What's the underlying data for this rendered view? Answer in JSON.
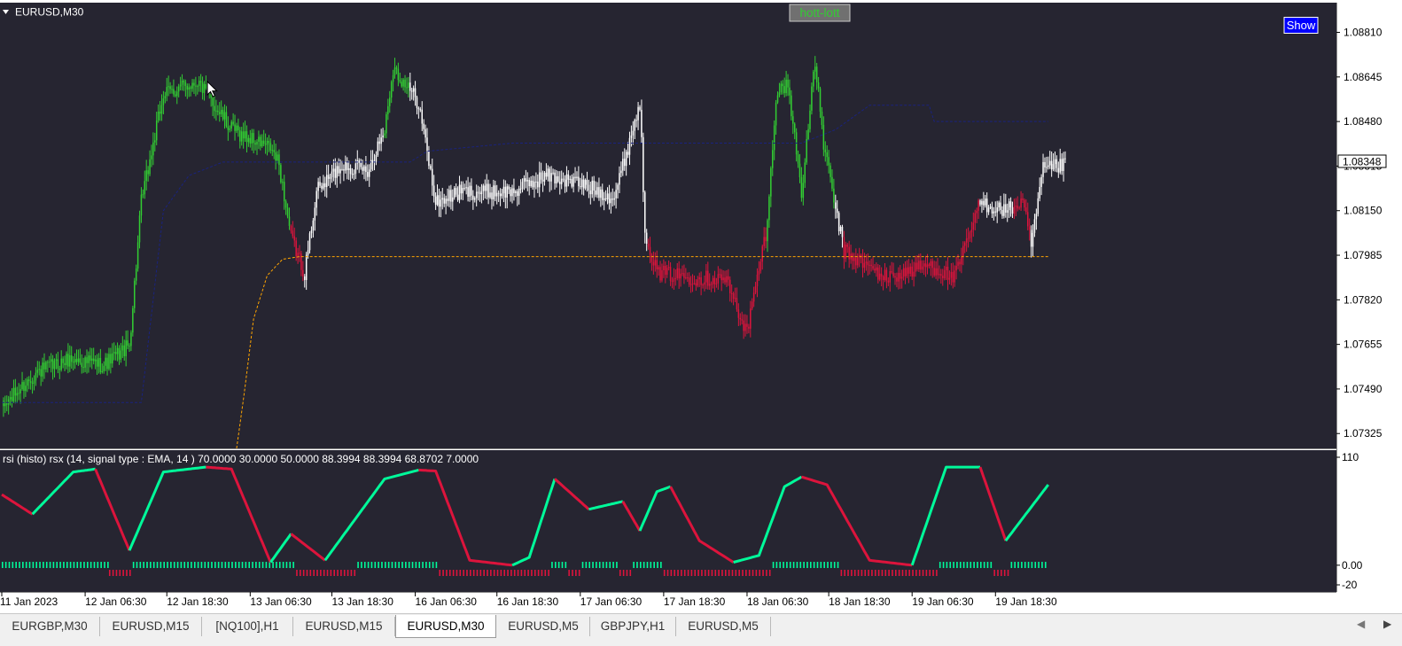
{
  "window": {
    "symbol_title": "EURUSD,M30"
  },
  "overlay": {
    "hott_lott_label": "hott-lott",
    "show_button": "Show"
  },
  "colors": {
    "background": "#262531",
    "bull": "#32cd32",
    "bear": "#dc143c",
    "neutral": "#ffffff",
    "rsx_up": "#00fa9a",
    "rsx_down": "#dc143c",
    "ma_blue": "#1a237e",
    "ma_orange": "#ffa500"
  },
  "chart_data": [
    {
      "type": "candlestick",
      "symbol": "EURUSD",
      "timeframe": "M30",
      "price_ticks": [
        "1.08810",
        "1.08645",
        "1.08480",
        "1.08315",
        "1.08150",
        "1.07985",
        "1.07820",
        "1.07655",
        "1.07490",
        "1.07325"
      ],
      "current_price": "1.08348",
      "ylim": [
        1.0727,
        1.0892
      ],
      "anchors": [
        {
          "i": 0,
          "p": 1.0742
        },
        {
          "i": 20,
          "p": 1.0755
        },
        {
          "i": 40,
          "p": 1.076
        },
        {
          "i": 60,
          "p": 1.0758
        },
        {
          "i": 75,
          "p": 1.0765
        },
        {
          "i": 82,
          "p": 1.0818
        },
        {
          "i": 95,
          "p": 1.0858
        },
        {
          "i": 115,
          "p": 1.0863
        },
        {
          "i": 135,
          "p": 1.0845
        },
        {
          "i": 158,
          "p": 1.0838
        },
        {
          "i": 163,
          "p": 1.0832
        },
        {
          "i": 170,
          "p": 1.0805
        },
        {
          "i": 178,
          "p": 1.0792
        },
        {
          "i": 185,
          "p": 1.0822
        },
        {
          "i": 200,
          "p": 1.0832
        },
        {
          "i": 215,
          "p": 1.083
        },
        {
          "i": 225,
          "p": 1.0845
        },
        {
          "i": 230,
          "p": 1.0868
        },
        {
          "i": 245,
          "p": 1.0855
        },
        {
          "i": 255,
          "p": 1.0818
        },
        {
          "i": 270,
          "p": 1.0822
        },
        {
          "i": 300,
          "p": 1.0822
        },
        {
          "i": 320,
          "p": 1.0828
        },
        {
          "i": 340,
          "p": 1.0825
        },
        {
          "i": 360,
          "p": 1.082
        },
        {
          "i": 375,
          "p": 1.0855
        },
        {
          "i": 378,
          "p": 1.0808
        },
        {
          "i": 385,
          "p": 1.0792
        },
        {
          "i": 410,
          "p": 1.079
        },
        {
          "i": 425,
          "p": 1.079
        },
        {
          "i": 438,
          "p": 1.077
        },
        {
          "i": 450,
          "p": 1.081
        },
        {
          "i": 455,
          "p": 1.0858
        },
        {
          "i": 462,
          "p": 1.0862
        },
        {
          "i": 470,
          "p": 1.0822
        },
        {
          "i": 478,
          "p": 1.087
        },
        {
          "i": 483,
          "p": 1.084
        },
        {
          "i": 488,
          "p": 1.0822
        },
        {
          "i": 495,
          "p": 1.08
        },
        {
          "i": 520,
          "p": 1.079
        },
        {
          "i": 545,
          "p": 1.0795
        },
        {
          "i": 560,
          "p": 1.079
        },
        {
          "i": 575,
          "p": 1.0818
        },
        {
          "i": 590,
          "p": 1.0815
        },
        {
          "i": 600,
          "p": 1.0818
        },
        {
          "i": 605,
          "p": 1.0802
        },
        {
          "i": 612,
          "p": 1.083
        },
        {
          "i": 625,
          "p": 1.0832
        }
      ],
      "ma_blue": [
        {
          "i": 0,
          "p": 1.0744
        },
        {
          "i": 82,
          "p": 1.0744
        },
        {
          "i": 95,
          "p": 1.0815
        },
        {
          "i": 110,
          "p": 1.0828
        },
        {
          "i": 130,
          "p": 1.0833
        },
        {
          "i": 170,
          "p": 1.0833
        },
        {
          "i": 240,
          "p": 1.0833
        },
        {
          "i": 250,
          "p": 1.0837
        },
        {
          "i": 300,
          "p": 1.084
        },
        {
          "i": 470,
          "p": 1.084
        },
        {
          "i": 490,
          "p": 1.0845
        },
        {
          "i": 510,
          "p": 1.0854
        },
        {
          "i": 545,
          "p": 1.0854
        },
        {
          "i": 548,
          "p": 1.0848
        },
        {
          "i": 615,
          "p": 1.0848
        }
      ],
      "ma_orange": [
        {
          "i": 138,
          "p": 1.0727
        },
        {
          "i": 142,
          "p": 1.0745
        },
        {
          "i": 148,
          "p": 1.0775
        },
        {
          "i": 156,
          "p": 1.0791
        },
        {
          "i": 165,
          "p": 1.0797
        },
        {
          "i": 175,
          "p": 1.0798
        },
        {
          "i": 615,
          "p": 1.0798
        }
      ]
    },
    {
      "type": "line",
      "title": "rsi (histo) rsx (14, signal type : EMA, 14 ) 70.0000 30.0000 50.0000 88.3994 88.3994 68.8702 7.0000",
      "y_ticks": [
        "110",
        "0.00",
        "-20"
      ],
      "ylim": [
        -20,
        110
      ],
      "series": [
        {
          "name": "rsx",
          "points": [
            {
              "i": 0,
              "v": 72
            },
            {
              "i": 18,
              "v": 52
            },
            {
              "i": 42,
              "v": 95
            },
            {
              "i": 55,
              "v": 98
            },
            {
              "i": 75,
              "v": 15
            },
            {
              "i": 95,
              "v": 95
            },
            {
              "i": 120,
              "v": 100
            },
            {
              "i": 135,
              "v": 98
            },
            {
              "i": 158,
              "v": 3
            },
            {
              "i": 170,
              "v": 32
            },
            {
              "i": 190,
              "v": 5
            },
            {
              "i": 225,
              "v": 88
            },
            {
              "i": 245,
              "v": 97
            },
            {
              "i": 255,
              "v": 96
            },
            {
              "i": 275,
              "v": 5
            },
            {
              "i": 300,
              "v": 0
            },
            {
              "i": 310,
              "v": 8
            },
            {
              "i": 325,
              "v": 88
            },
            {
              "i": 345,
              "v": 57
            },
            {
              "i": 365,
              "v": 65
            },
            {
              "i": 375,
              "v": 35
            },
            {
              "i": 385,
              "v": 75
            },
            {
              "i": 393,
              "v": 80
            },
            {
              "i": 410,
              "v": 25
            },
            {
              "i": 430,
              "v": 3
            },
            {
              "i": 445,
              "v": 10
            },
            {
              "i": 460,
              "v": 80
            },
            {
              "i": 470,
              "v": 90
            },
            {
              "i": 485,
              "v": 82
            },
            {
              "i": 510,
              "v": 5
            },
            {
              "i": 535,
              "v": 0
            },
            {
              "i": 555,
              "v": 100
            },
            {
              "i": 575,
              "v": 100
            },
            {
              "i": 590,
              "v": 25
            },
            {
              "i": 615,
              "v": 82
            }
          ]
        }
      ],
      "histogram": [
        {
          "s": 0,
          "e": 63,
          "d": "up"
        },
        {
          "s": 63,
          "e": 77,
          "d": "down"
        },
        {
          "s": 77,
          "e": 173,
          "d": "up"
        },
        {
          "s": 173,
          "e": 185,
          "d": "down"
        },
        {
          "s": 185,
          "e": 209,
          "d": "down"
        },
        {
          "s": 209,
          "e": 257,
          "d": "up"
        },
        {
          "s": 257,
          "e": 323,
          "d": "down"
        },
        {
          "s": 323,
          "e": 333,
          "d": "up"
        },
        {
          "s": 333,
          "e": 341,
          "d": "down"
        },
        {
          "s": 341,
          "e": 363,
          "d": "up"
        },
        {
          "s": 363,
          "e": 371,
          "d": "down"
        },
        {
          "s": 371,
          "e": 389,
          "d": "up"
        },
        {
          "s": 389,
          "e": 453,
          "d": "down"
        },
        {
          "s": 453,
          "e": 493,
          "d": "up"
        },
        {
          "s": 493,
          "e": 551,
          "d": "down"
        },
        {
          "s": 551,
          "e": 583,
          "d": "up"
        },
        {
          "s": 583,
          "e": 593,
          "d": "down"
        },
        {
          "s": 593,
          "e": 615,
          "d": "up"
        }
      ]
    }
  ],
  "time_labels": [
    {
      "i": 0,
      "label": "11 Jan 2023"
    },
    {
      "i": 49,
      "label": "12 Jan 06:30"
    },
    {
      "i": 97,
      "label": "12 Jan 18:30"
    },
    {
      "i": 146,
      "label": "13 Jan 06:30"
    },
    {
      "i": 194,
      "label": "13 Jan 18:30"
    },
    {
      "i": 243,
      "label": "16 Jan 06:30"
    },
    {
      "i": 291,
      "label": "16 Jan 18:30"
    },
    {
      "i": 340,
      "label": "17 Jan 06:30"
    },
    {
      "i": 389,
      "label": "17 Jan 18:30"
    },
    {
      "i": 438,
      "label": "18 Jan 06:30"
    },
    {
      "i": 486,
      "label": "18 Jan 18:30"
    },
    {
      "i": 535,
      "label": "19 Jan 06:30"
    },
    {
      "i": 584,
      "label": "19 Jan 18:30"
    }
  ],
  "tabs": [
    {
      "label": "EURGBP,M30",
      "active": false
    },
    {
      "label": "EURUSD,M15",
      "active": false
    },
    {
      "label": "[NQ100],H1",
      "active": false
    },
    {
      "label": "EURUSD,M15",
      "active": false
    },
    {
      "label": "EURUSD,M30",
      "active": true
    },
    {
      "label": "EURUSD,M5",
      "active": false
    },
    {
      "label": "GBPJPY,H1",
      "active": false
    },
    {
      "label": "EURUSD,M5",
      "active": false
    }
  ],
  "icons": {
    "mouse_cursor": "pointer-cursor-icon",
    "tab_scroll_left": "chevron-left-icon",
    "tab_scroll_right": "chevron-right-icon",
    "title_dropdown": "triangle-down-icon"
  }
}
